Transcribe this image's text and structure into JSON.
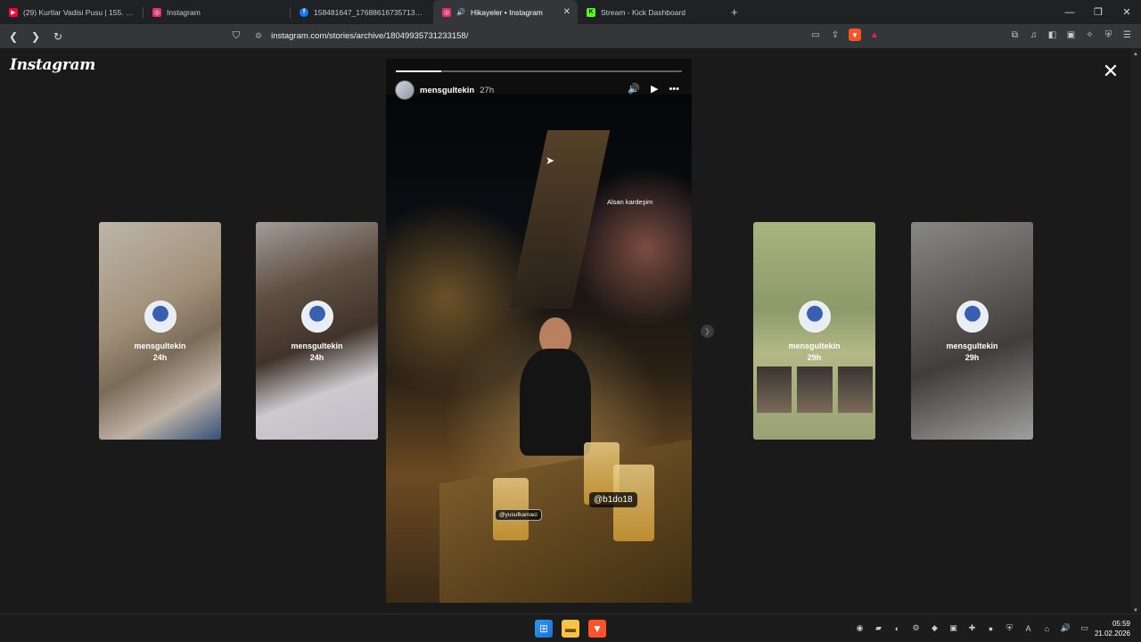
{
  "browser": {
    "tabs": [
      {
        "label": "(29) Kurtlar Vadisi Pusu | 155. Bölüm",
        "icon": "youtube-icon",
        "color": "#ff0033"
      },
      {
        "label": "Instagram",
        "icon": "instagram-icon",
        "color": "#e1306c"
      },
      {
        "label": "158481647_176886167357132_7207",
        "icon": "facebook-icon",
        "color": "#1877f2"
      },
      {
        "label": "Hikayeler • Instagram",
        "icon": "instagram-icon",
        "color": "#e1306c",
        "active": true
      },
      {
        "label": "Stream - Kick Dashboard",
        "icon": "kick-icon",
        "color": "#53fc18"
      }
    ],
    "url": "instagram.com/stories/archive/18049935731233158/"
  },
  "instagram": {
    "logo": "Instagram",
    "story": {
      "username": "mensgultekin",
      "time": "27h",
      "caption": "Alsan kardeşim",
      "tags": [
        "@b1do18",
        "@yusufkamaci"
      ],
      "progress": 0.16
    },
    "cards": [
      {
        "username": "mensgultekin",
        "time": "24h"
      },
      {
        "username": "mensgultekin",
        "time": "24h"
      },
      {
        "username": "mensgultekin",
        "time": "29h"
      },
      {
        "username": "mensgultekin",
        "time": "29h"
      }
    ]
  },
  "taskbar": {
    "time": "05:59",
    "date": "21.02.2026"
  }
}
